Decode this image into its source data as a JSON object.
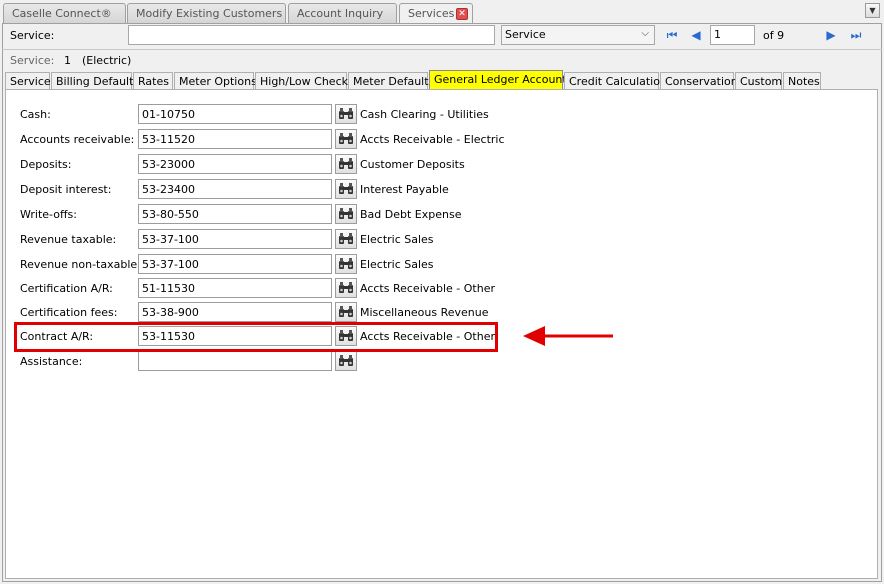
{
  "top_tabs": [
    {
      "label": "Caselle Connect®"
    },
    {
      "label": "Modify Existing Customers"
    },
    {
      "label": "Account Inquiry"
    },
    {
      "label": "Services",
      "active": true
    }
  ],
  "tab_close_icon": "close-icon",
  "overflow_icon": "chevron-down-icon",
  "service_bar": {
    "label": "Service:",
    "search_value": "",
    "select_value": "Service",
    "page_value": "1",
    "page_of": "of 9"
  },
  "service_info": {
    "label": "Service:",
    "number": "1",
    "name": "(Electric)"
  },
  "sub_tabs": [
    {
      "label": "Service"
    },
    {
      "label": "Billing Defaults"
    },
    {
      "label": "Rates"
    },
    {
      "label": "Meter Options"
    },
    {
      "label": "High/Low Checks"
    },
    {
      "label": "Meter Defaults"
    },
    {
      "label": "General Ledger Accounts",
      "active": true
    },
    {
      "label": "Credit Calculation"
    },
    {
      "label": "Conservation"
    },
    {
      "label": "Custom"
    },
    {
      "label": "Notes"
    }
  ],
  "gl_accounts": [
    {
      "label": "Cash:",
      "account": "01-10750",
      "description": "Cash Clearing - Utilities"
    },
    {
      "label": "Accounts receivable:",
      "account": "53-11520",
      "description": "Accts Receivable - Electric"
    },
    {
      "label": "Deposits:",
      "account": "53-23000",
      "description": "Customer Deposits"
    },
    {
      "label": "Deposit interest:",
      "account": "53-23400",
      "description": "Interest Payable"
    },
    {
      "label": "Write-offs:",
      "account": "53-80-550",
      "description": "Bad Debt Expense"
    },
    {
      "label": "Revenue taxable:",
      "account": "53-37-100",
      "description": "Electric Sales"
    },
    {
      "label": "Revenue non-taxable:",
      "account": "53-37-100",
      "description": "Electric Sales"
    },
    {
      "label": "Certification A/R:",
      "account": "51-11530",
      "description": "Accts Receivable - Other"
    },
    {
      "label": "Certification fees:",
      "account": "53-38-900",
      "description": "Miscellaneous Revenue"
    },
    {
      "label": "Contract A/R:",
      "account": "53-11530",
      "description": "Accts Receivable - Other"
    },
    {
      "label": "Assistance:",
      "account": "",
      "description": ""
    }
  ],
  "colors": {
    "active_subtab": "#ffff00",
    "annotation": "#e00000",
    "nav_icons": "#2a6ad0"
  }
}
